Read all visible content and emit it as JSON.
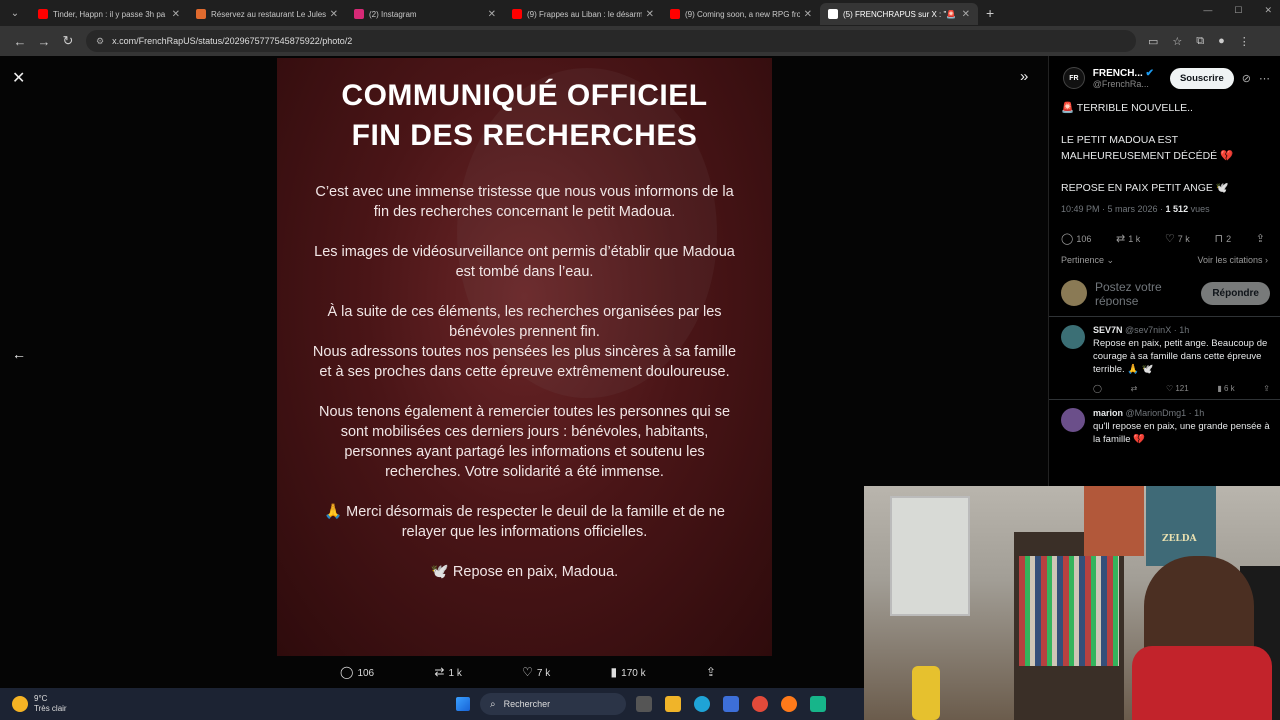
{
  "browser": {
    "tabs": [
      {
        "title": "Tinder, Happn : il y passe 3h pa",
        "color": "#ff0000",
        "active": false
      },
      {
        "title": "Réservez au restaurant Le Jules",
        "color": "#e06a2e",
        "active": false
      },
      {
        "title": "(2) Instagram",
        "color": "#d62976",
        "active": false
      },
      {
        "title": "(9) Frappes au Liban : le désarm",
        "color": "#ff0000",
        "active": false
      },
      {
        "title": "(9) Coming soon, a new RPG fro",
        "color": "#ff0000",
        "active": false
      },
      {
        "title": "(5) FRENCHRAPUS sur X : \"🚨",
        "color": "#ffffff",
        "active": true
      }
    ],
    "url": "x.com/FrenchRapUS/status/2029675777545875922/photo/2"
  },
  "photo": {
    "title_line1": "COMMUNIQUÉ OFFICIEL",
    "title_line2": "FIN DES RECHERCHES",
    "paragraphs": [
      "C’est avec une immense tristesse que nous vous informons de la fin des recherches concernant le petit Madoua.",
      "Les images de vidéosurveillance ont permis d’établir que Madoua est tombé dans l’eau.",
      "À la suite de ces éléments, les recherches organisées par les bénévoles prennent fin.",
      "Nous adressons toutes nos pensées les plus sincères à sa famille et à ses proches dans cette épreuve extrêmement douloureuse.",
      "Nous tenons également à remercier toutes les personnes qui se sont mobilisées ces derniers jours : bénévoles, habitants, personnes ayant partagé les informations et soutenu les recherches. Votre solidarité a été immense.",
      "🙏 Merci désormais de respecter le deuil de la famille et de ne relayer que les informations officielles.",
      "🕊️ Repose en paix, Madoua."
    ]
  },
  "photo_actions": {
    "replies": "106",
    "reposts": "1 k",
    "likes": "7 k",
    "views": "170 k"
  },
  "post": {
    "author_name": "FRENCH...",
    "author_handle": "@FrenchRa...",
    "avatar_text": "FR",
    "subscribe_label": "Souscrire",
    "lines": [
      "🚨 TERRIBLE NOUVELLE..",
      "LE PETIT MADOUA EST MALHEUREUSEMENT DÉCÉDÉ 💔",
      "REPOSE EN PAIX PETIT ANGE 🕊️"
    ],
    "time": "10:49 PM · 5 mars 2026 · ",
    "views_count": "1 512",
    "views_label": " vues",
    "replies": "106",
    "reposts": "1 k",
    "likes": "7 k",
    "bookmarks": "2",
    "sort_label": "Pertinence ⌄",
    "quotes_label": "Voir les citations ›",
    "reply_placeholder": "Postez votre réponse",
    "reply_button": "Répondre"
  },
  "replies": [
    {
      "name": "SEV7N",
      "handle": "@sev7ninX · 1h",
      "text": "Repose en paix, petit ange. Beaucoup de courage à sa famille dans cette épreuve terrible. 🙏 🕊️",
      "likes": "121",
      "views": "6 k",
      "color": "#3b6f75"
    },
    {
      "name": "marion",
      "handle": "@MarionDmg1 · 1h",
      "text": "qu'll repose en paix, une grande pensée à la famille 💔",
      "likes": "",
      "views": "",
      "color": "#6b4f8a"
    }
  ],
  "webcam": {
    "poster_text": "ZELDA"
  },
  "taskbar": {
    "temp": "9°C",
    "weather": "Très clair",
    "search_label": "Rechercher"
  }
}
